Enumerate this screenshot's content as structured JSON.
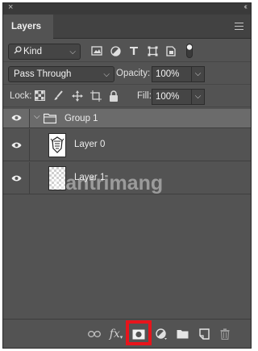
{
  "panel": {
    "close_glyph": "×",
    "collapse_glyph": "‹‹",
    "tab_label": "Layers",
    "menu_icon": "hamburger-menu-icon"
  },
  "filter": {
    "kind_label": "Kind",
    "icons": [
      "image-filter-icon",
      "adjustment-filter-icon",
      "type-filter-icon",
      "shape-filter-icon",
      "smart-object-filter-icon",
      "filter-toggle-icon"
    ]
  },
  "blend": {
    "mode": "Pass Through",
    "opacity_label": "Opacity:",
    "opacity_value": "100%"
  },
  "lock": {
    "label": "Lock:",
    "icons": [
      "lock-transparent-pixels-icon",
      "lock-image-pixels-icon",
      "lock-position-icon",
      "lock-artboard-icon",
      "lock-all-icon"
    ],
    "fill_label": "Fill:",
    "fill_value": "100%"
  },
  "layers": [
    {
      "name": "Group 1",
      "type": "group",
      "visible": true,
      "expanded": true
    },
    {
      "name": "Layer 0",
      "type": "pixel",
      "visible": true
    },
    {
      "name": "Layer 1",
      "type": "pixel",
      "visible": true
    }
  ],
  "watermark": "uantrimang",
  "bottom_bar": {
    "icons": [
      "link-layers-icon",
      "fx-icon",
      "add-mask-icon",
      "adjustment-layer-icon",
      "new-group-icon",
      "new-layer-icon",
      "trash-icon"
    ],
    "fx_label": "fx",
    "highlight_color": "#e8141b"
  },
  "colors": {
    "panel_bg": "#535353",
    "selected_row": "#6b6b6b"
  }
}
